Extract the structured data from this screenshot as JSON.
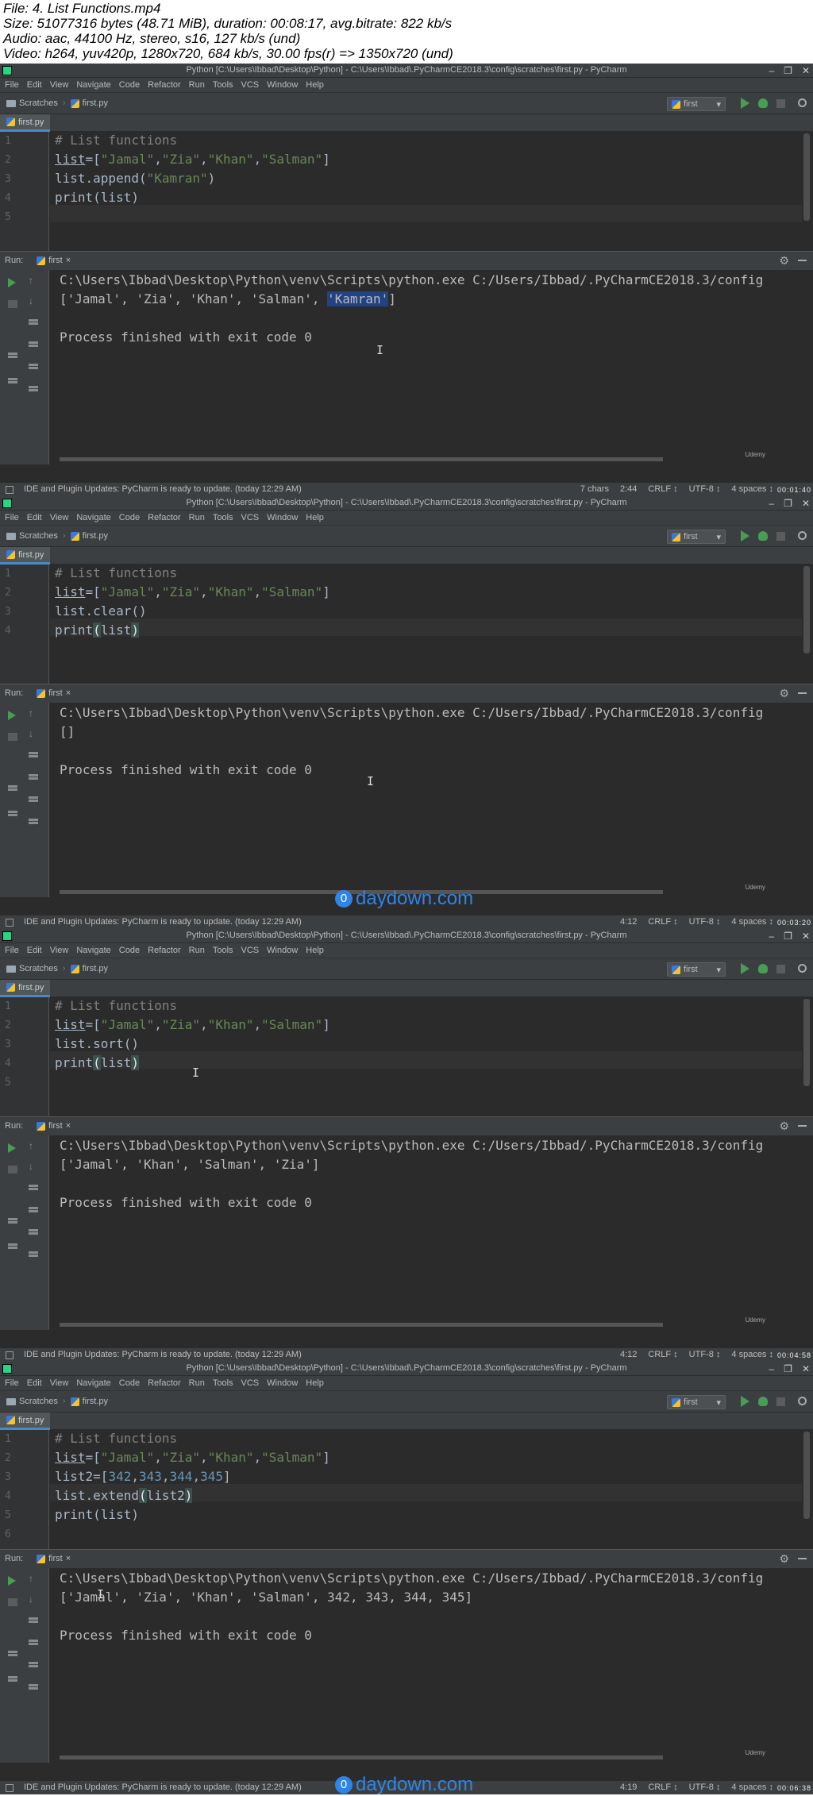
{
  "info": {
    "file": "File: 4. List Functions.mp4",
    "size": "Size: 51077316 bytes (48.71 MiB), duration: 00:08:17, avg.bitrate: 822 kb/s",
    "audio": "Audio: aac, 44100 Hz, stereo, s16, 127 kb/s (und)",
    "video": "Video: h264, yuv420p, 1280x720, 684 kb/s, 30.00 fps(r) => 1350x720 (und)"
  },
  "common": {
    "title": "Python [C:\\Users\\Ibbad\\Desktop\\Python] - C:\\Users\\Ibbad\\.PyCharmCE2018.3\\config\\scratches\\first.py - PyCharm",
    "menu": [
      "File",
      "Edit",
      "View",
      "Navigate",
      "Code",
      "Refactor",
      "Run",
      "Tools",
      "VCS",
      "Window",
      "Help"
    ],
    "crumb_scratches": "Scratches",
    "crumb_file": "first.py",
    "run_config": "first",
    "tab_file": "first.py",
    "run_label": "Run:",
    "run_tab": "first",
    "status_msg": "IDE and Plugin Updates: PyCharm is ready to update. (today 12:29 AM)",
    "crlf": "CRLF ↕",
    "encoding": "UTF-8 ↕",
    "indent": "4 spaces ↕",
    "brand": "Udemy",
    "cmd": "C:\\Users\\Ibbad\\Desktop\\Python\\venv\\Scripts\\python.exe C:/Users/Ibbad/.PyCharmCE2018.3/config",
    "exit": "Process finished with exit code 0"
  },
  "frames": [
    {
      "status_left": "7 chars",
      "pos": "2:44",
      "timestamp": "00:01:40",
      "output_pre": "['Jamal', 'Zia', 'Khan', 'Salman', ",
      "output_sel": "'Kamran'",
      "output_post": "]"
    },
    {
      "status_left": "",
      "pos": "4:12",
      "timestamp": "00:03:20",
      "output": "[]"
    },
    {
      "status_left": "",
      "pos": "4:12",
      "timestamp": "00:04:58",
      "output": "['Jamal', 'Khan', 'Salman', 'Zia']"
    },
    {
      "status_left": "",
      "pos": "4:19",
      "timestamp": "00:06:38",
      "output": "['Jamal', 'Zia', 'Khan', 'Salman', 342, 343, 344, 345]"
    }
  ],
  "code": {
    "comment": "# List functions",
    "list_kw": "list",
    "assign_open": "=[",
    "s_jamal": "\"Jamal\"",
    "s_zia": "\"Zia\"",
    "s_khan": "\"Khan\"",
    "s_salman": "\"Salman\"",
    "comma": ",",
    "close": "]",
    "append_pre": "list.append(",
    "s_kamran": "\"Kamran\"",
    "paren_close": ")",
    "print_line": "print(list)",
    "clear_line": "list.clear()",
    "sort_line": "list.sort()",
    "print_kw": "print",
    "paren_open": "(",
    "list_word": "list",
    "list2_pre": "list2=[",
    "n342": "342",
    "n343": "343",
    "n344": "344",
    "n345": "345",
    "extend_pre": "list.extend",
    "list2_word": "list2"
  },
  "watermark": "daydown.com",
  "watermark_badge": "0"
}
